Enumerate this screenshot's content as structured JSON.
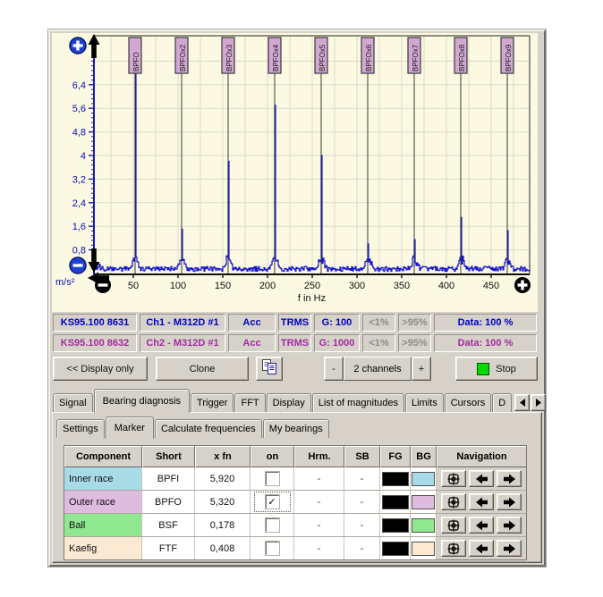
{
  "chart": {
    "bg": "#FBF9E1",
    "unit_label": "m/s²",
    "x_axis_label": "f in Hz",
    "x_ticks": [
      50,
      100,
      150,
      200,
      250,
      300,
      350,
      400,
      450
    ],
    "y_tick_labels": [
      "0,8",
      "1,6",
      "2,4",
      "3,2",
      "4",
      "4,8",
      "5,6",
      "6,4"
    ],
    "y_tick_values": [
      0.8,
      1.6,
      2.4,
      3.2,
      4,
      4.8,
      5.6,
      6.4
    ],
    "axis_color": "#1A1AB4",
    "line_color": "#1414CE",
    "flag_fill": "#D2A8D2",
    "flag_border": "#3A3A3A",
    "grid_color": "#DCDACA"
  },
  "chart_data": {
    "type": "line",
    "title": "",
    "xlabel": "f in Hz",
    "ylabel": "m/s²",
    "xlim": [
      0,
      493
    ],
    "ylim": [
      0,
      8
    ],
    "grid": true,
    "noise_floor": 0.2,
    "markers": [
      {
        "label": "BPFO",
        "freq": 52,
        "amplitude": 6.9
      },
      {
        "label": "BPFOx2",
        "freq": 104,
        "amplitude": 1.5
      },
      {
        "label": "BPFOx3",
        "freq": 156,
        "amplitude": 3.8
      },
      {
        "label": "BPFOx4",
        "freq": 208,
        "amplitude": 5.7
      },
      {
        "label": "BPFOx5",
        "freq": 260,
        "amplitude": 4.0
      },
      {
        "label": "BPFOx6",
        "freq": 312,
        "amplitude": 1.0
      },
      {
        "label": "BPFOx7",
        "freq": 364,
        "amplitude": 1.15
      },
      {
        "label": "BPFOx8",
        "freq": 416,
        "amplitude": 1.9
      },
      {
        "label": "BPFOx9",
        "freq": 468,
        "amplitude": 1.45
      }
    ]
  },
  "icons": {
    "zoom_in": "+",
    "zoom_out": "−",
    "pan_up": "↑",
    "pan_down": "↓",
    "pan_left": "←",
    "x_zoom_out": "−",
    "x_zoom_in": "+",
    "copy": "⎘",
    "stop": "■",
    "tab_prev": "◀",
    "tab_next": "▶",
    "nav_center": "⊞",
    "nav_prev": "←",
    "nav_next": "→"
  },
  "channels": {
    "rows": [
      {
        "device": "KS95.100 8631",
        "channel": "Ch1 - M312D #1",
        "quantity": "Acc",
        "mode": "TRMS",
        "gain": "G: 100",
        "under": "<1%",
        "over": ">95%",
        "data": "Data: 100 %",
        "color": "#0000C8"
      },
      {
        "device": "KS95.100 8632",
        "channel": "Ch2 - M312D #1",
        "quantity": "Acc",
        "mode": "TRMS",
        "gain": "G: 1000",
        "under": "<1%",
        "over": ">95%",
        "data": "Data: 100 %",
        "color": "#A12CA1"
      }
    ]
  },
  "toolbar": {
    "display_only": "<< Display only",
    "clone": "Clone",
    "minus": "-",
    "channels": "2 channels",
    "plus": "+",
    "stop": "Stop",
    "stop_color": "#00D800"
  },
  "main_tabs": {
    "items": [
      "Signal",
      "Bearing diagnosis",
      "Trigger",
      "FFT",
      "Display",
      "List of magnitudes",
      "Limits",
      "Cursors",
      "D"
    ],
    "active": "Bearing diagnosis"
  },
  "sub_tabs": {
    "items": [
      "Settings",
      "Marker",
      "Calculate frequencies",
      "My bearings"
    ],
    "active": "Marker"
  },
  "marker_table": {
    "headers": [
      "Component",
      "Short",
      "x fn",
      "on",
      "Hrm.",
      "SB",
      "FG",
      "BG",
      "Navigation"
    ],
    "rows": [
      {
        "component": "Inner race",
        "short": "BPFI",
        "x_fn": "5,920",
        "on": false,
        "hrm": "-",
        "sb": "-",
        "fg": "#000000",
        "bg": "#A8DBE8",
        "row_color": "#A8DBE8"
      },
      {
        "component": "Outer race",
        "short": "BPFO",
        "x_fn": "5,320",
        "on": true,
        "hrm": "-",
        "sb": "-",
        "fg": "#000000",
        "bg": "#DFBCDF",
        "row_color": "#DFBCDF"
      },
      {
        "component": "Ball",
        "short": "BSF",
        "x_fn": "0,178",
        "on": false,
        "hrm": "-",
        "sb": "-",
        "fg": "#000000",
        "bg": "#8FE88F",
        "row_color": "#8FE88F"
      },
      {
        "component": "Kaefig",
        "short": "FTF",
        "x_fn": "0,408",
        "on": false,
        "hrm": "-",
        "sb": "-",
        "fg": "#000000",
        "bg": "#FBE9D2",
        "row_color": "#FBE9D2"
      }
    ]
  }
}
